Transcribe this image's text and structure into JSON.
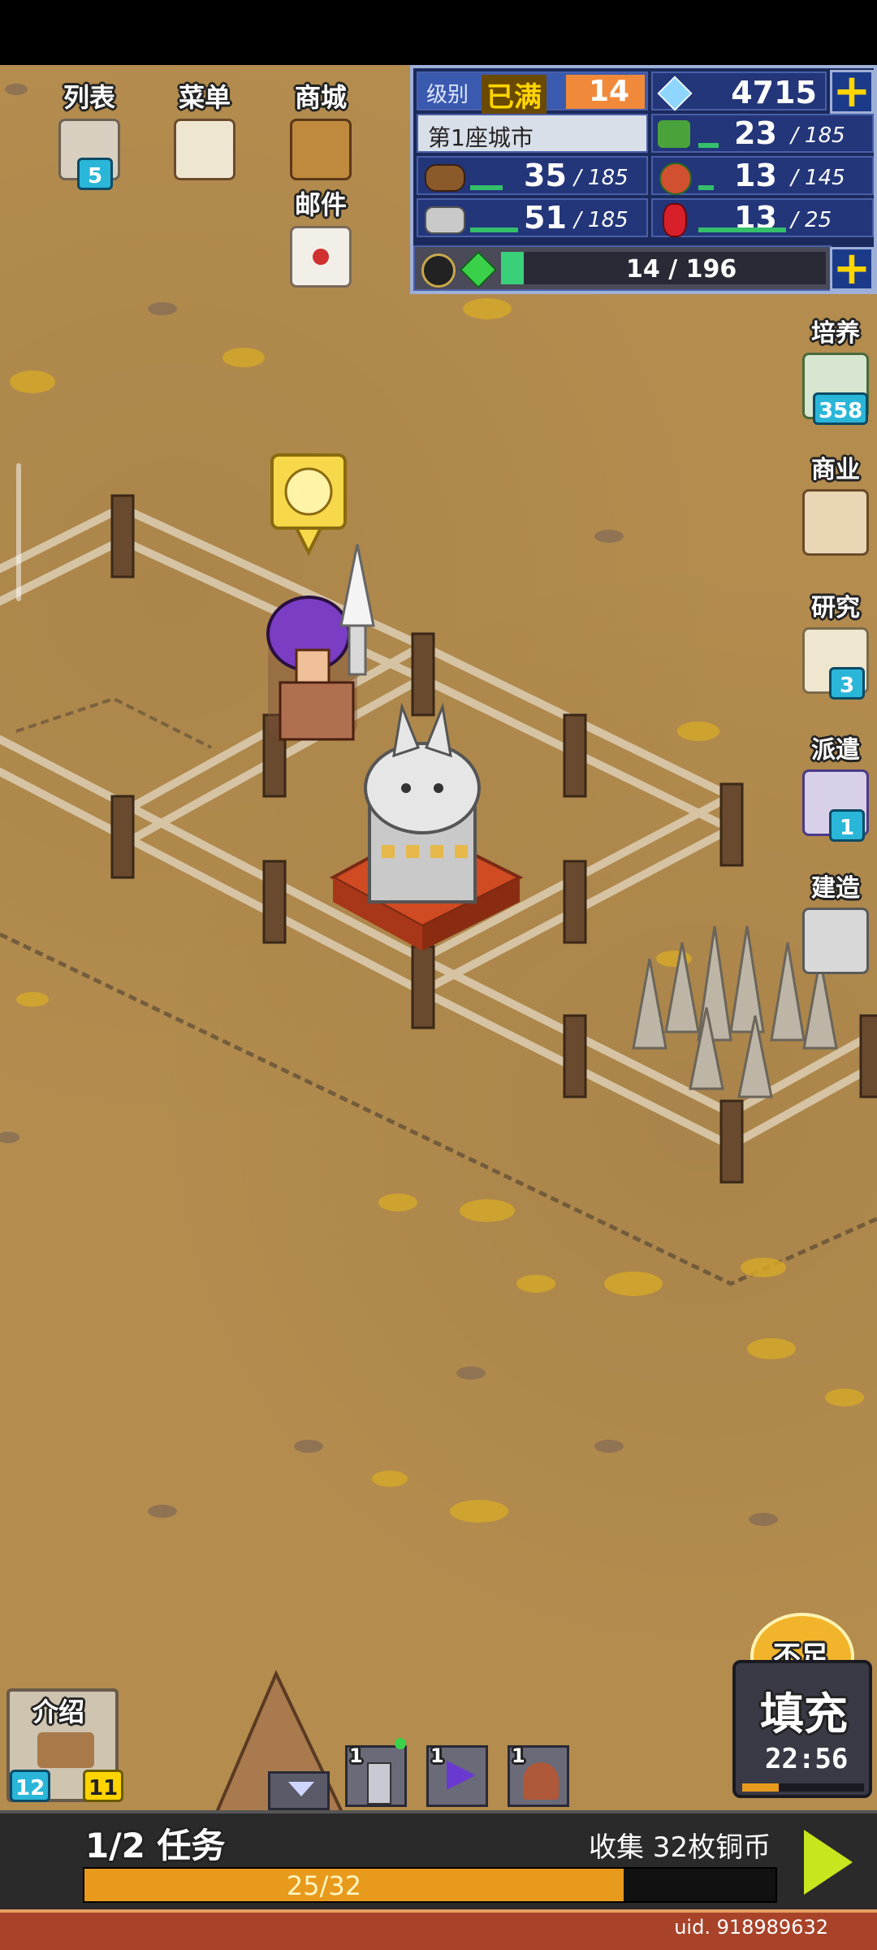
{
  "top_menu": {
    "list_label": "列表",
    "list_badge": "5",
    "menu_label": "菜单",
    "shop_label": "商城",
    "mail_label": "邮件"
  },
  "resources": {
    "level_label": "级别",
    "level_status": "已满",
    "level_value": "14",
    "gems": "4715",
    "city_name": "第1座城市",
    "grass_value": "23",
    "grass_max": "185",
    "grass_fill": 0.12,
    "wood_value": "35",
    "wood_max": "185",
    "wood_fill": 0.19,
    "food_value": "13",
    "food_max": "145",
    "food_fill": 0.09,
    "stone_value": "51",
    "stone_max": "185",
    "stone_fill": 0.28,
    "ruby_value": "13",
    "ruby_max": "25",
    "ruby_fill": 0.52,
    "exp_text": "14 / 196",
    "exp_fill": 0.07
  },
  "side_menu": {
    "train_label": "培养",
    "train_badge": "358",
    "business_label": "商业",
    "research_label": "研究",
    "research_badge": "3",
    "dispatch_label": "派遣",
    "dispatch_badge": "1",
    "build_label": "建造"
  },
  "bottom": {
    "intro_label": "介绍",
    "intro_badge_left": "12",
    "intro_badge_right": "11",
    "slot1_count": "1",
    "slot2_count": "1",
    "slot3_count": "1",
    "refill_stamp": "不足",
    "refill_label": "填充",
    "refill_timer": "22:56",
    "quest_progress": "1/2 任务",
    "quest_desc": "收集 32枚铜币",
    "quest_bar_text": "25/32",
    "quest_fill": 0.78,
    "uid": "uid. 918989632"
  },
  "colors": {
    "ground": "#b48c4e",
    "panel": "#1b2a5c",
    "accent_yellow": "#ffd400",
    "quest_fill": "#e89a1c",
    "badge": "#2ab6d8"
  }
}
